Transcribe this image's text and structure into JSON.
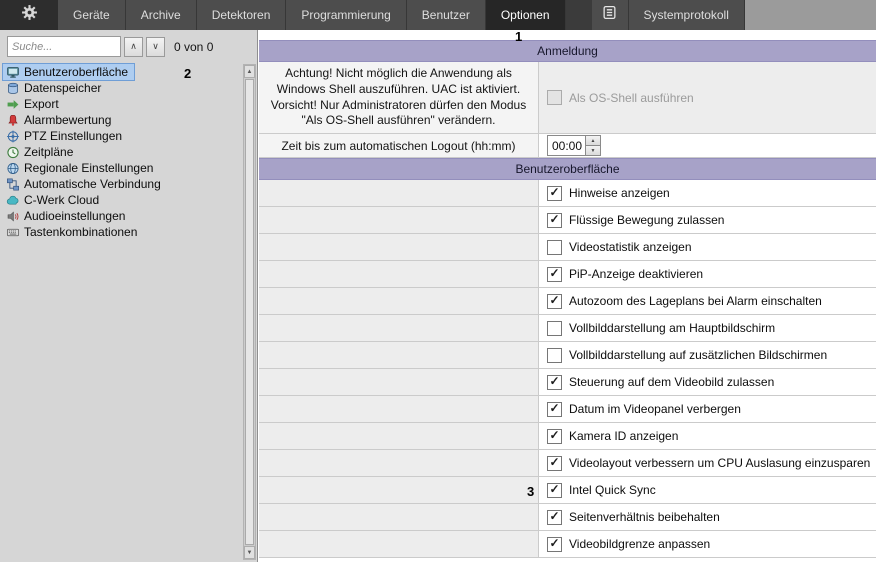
{
  "topbar": {
    "gear_icon": "gear-icon",
    "tabs": [
      {
        "label": "Geräte",
        "selected": false
      },
      {
        "label": "Archive",
        "selected": false
      },
      {
        "label": "Detektoren",
        "selected": false
      },
      {
        "label": "Programmierung",
        "selected": false
      },
      {
        "label": "Benutzer",
        "selected": false
      },
      {
        "label": "Optionen",
        "selected": true
      }
    ],
    "log_icon": "system-log-icon",
    "log_tab_label": "Systemprotokoll"
  },
  "sidebar": {
    "search": {
      "placeholder": "Suche...",
      "count": "0 von 0"
    },
    "tree": [
      {
        "label": "Benutzeroberfläche",
        "icon": "monitor-icon",
        "selected": true
      },
      {
        "label": "Datenspeicher",
        "icon": "storage-icon",
        "selected": false
      },
      {
        "label": "Export",
        "icon": "export-icon",
        "selected": false
      },
      {
        "label": "Alarmbewertung",
        "icon": "alarm-icon",
        "selected": false
      },
      {
        "label": "PTZ Einstellungen",
        "icon": "ptz-icon",
        "selected": false
      },
      {
        "label": "Zeitpläne",
        "icon": "schedule-icon",
        "selected": false
      },
      {
        "label": "Regionale Einstellungen",
        "icon": "region-icon",
        "selected": false
      },
      {
        "label": "Automatische Verbindung",
        "icon": "connection-icon",
        "selected": false
      },
      {
        "label": "C-Werk Cloud",
        "icon": "cloud-icon",
        "selected": false
      },
      {
        "label": "Audioeinstellungen",
        "icon": "audio-icon",
        "selected": false
      },
      {
        "label": "Tastenkombinationen",
        "icon": "keyboard-icon",
        "selected": false
      }
    ]
  },
  "main": {
    "section1_title": "Anmeldung",
    "section2_title": "Benutzeroberfläche",
    "anmeldung": {
      "warning_text": "Achtung! Nicht möglich die Anwendung als Windows Shell auszuführen. UAC ist aktiviert. Vorsicht! Nur Administratoren dürfen den Modus \"Als OS-Shell ausführen\" verändern.",
      "os_shell_label": "Als OS-Shell ausführen",
      "os_shell_checked": false,
      "os_shell_disabled": true,
      "logout_label": "Zeit bis zum automatischen Logout (hh:mm)",
      "logout_value": "00:00"
    },
    "ui_options": [
      {
        "label": "Hinweise anzeigen",
        "checked": true
      },
      {
        "label": "Flüssige Bewegung zulassen",
        "checked": true
      },
      {
        "label": "Videostatistik anzeigen",
        "checked": false
      },
      {
        "label": "PiP-Anzeige deaktivieren",
        "checked": true
      },
      {
        "label": "Autozoom des Lageplans bei Alarm einschalten",
        "checked": true
      },
      {
        "label": "Vollbilddarstellung am Hauptbildschirm",
        "checked": false
      },
      {
        "label": "Vollbilddarstellung auf zusätzlichen Bildschirmen",
        "checked": false
      },
      {
        "label": "Steuerung auf dem Videobild zulassen",
        "checked": true
      },
      {
        "label": "Datum im Videopanel verbergen",
        "checked": true
      },
      {
        "label": "Kamera ID anzeigen",
        "checked": true
      },
      {
        "label": "Videolayout verbessern um CPU Auslasung einzusparen",
        "checked": true
      },
      {
        "label": "Intel  Quick Sync",
        "checked": true
      },
      {
        "label": "Seitenverhältnis beibehalten",
        "checked": true
      },
      {
        "label": "Videobildgrenze anpassen",
        "checked": true
      }
    ]
  },
  "annotations": [
    "1",
    "2",
    "3"
  ],
  "colors": {
    "header_accent": "#a7a2c8",
    "selection": "#aecdf0",
    "topbar": "#3b3b3b"
  }
}
